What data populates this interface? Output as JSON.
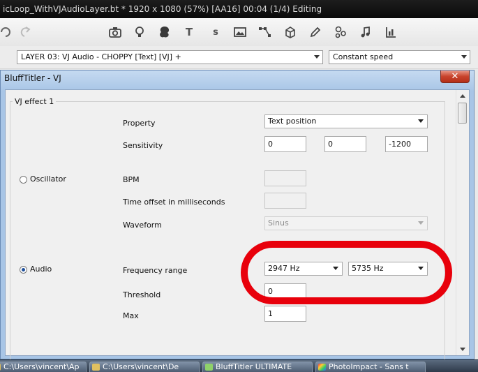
{
  "window": {
    "title": "icLoop_WithVJAudioLayer.bt * 1920 x 1080 (57%) [AA16] 00:04 (1/4) Editing"
  },
  "toolbar": {
    "text_tool_label": "T",
    "symbol_tool_label": "s"
  },
  "layer_row": {
    "layer_select": "LAYER 03: VJ Audio - CHOPPY [Text] [VJ] +",
    "speed_select": "Constant speed"
  },
  "dialog": {
    "title": "BluffTitler - VJ",
    "close_label": "✕",
    "group_label": "VJ effect 1",
    "property": {
      "label": "Property",
      "value": "Text position"
    },
    "sensitivity": {
      "label": "Sensitivity",
      "values": [
        "0",
        "0",
        "-1200"
      ]
    },
    "oscillator": {
      "label": "Oscillator",
      "bpm_label": "BPM",
      "bpm_value": "",
      "offset_label": "Time offset in milliseconds",
      "offset_value": "",
      "waveform_label": "Waveform",
      "waveform_value": "Sinus"
    },
    "audio": {
      "label": "Audio",
      "freq_label": "Frequency range",
      "freq_low": "2947 Hz",
      "freq_high": "5735 Hz",
      "threshold_label": "Threshold",
      "threshold_value": "0",
      "max_label": "Max",
      "max_value": "1"
    }
  },
  "taskbar": {
    "items": [
      "C:\\Users\\vincent\\Ap",
      "C:\\Users\\vincent\\De",
      "BluffTitler ULTIMATE",
      "PhotoImpact - Sans t"
    ]
  },
  "colors": {
    "highlight": "#e8000b",
    "dialog_frame": "#a8c5e6"
  }
}
